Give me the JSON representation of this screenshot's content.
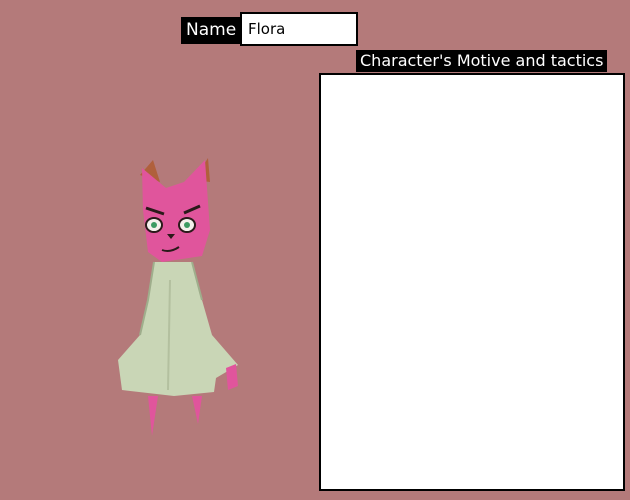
{
  "name_label": "Name",
  "name_value": "Flora",
  "motive_label": "Character's Motive and tactics",
  "motive_text": "",
  "colors": {
    "background": "#b47a7a",
    "head": "#e0559c",
    "dress": "#c9d6b6",
    "panel": "#ffffff",
    "label_bg": "#000000"
  }
}
